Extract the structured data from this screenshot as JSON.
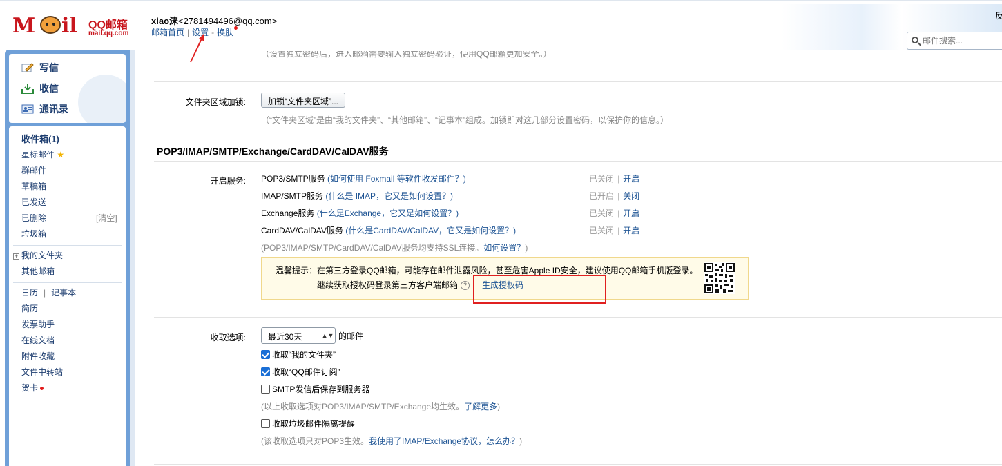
{
  "header": {
    "logo_text_m": "M",
    "logo_text_il": "il",
    "logo_brand": "QQ邮箱",
    "logo_url": "mail.qq.com",
    "account_name": "xiao涞",
    "account_email": "<2781494496@qq.com>",
    "link_home": "邮箱首页",
    "link_settings": "设置",
    "link_skin": "换肤",
    "corner_text": "反",
    "search_placeholder": "邮件搜索..."
  },
  "sidebar_top": {
    "write": "写信",
    "receive": "收信",
    "contacts": "通讯录"
  },
  "sidebar": {
    "inbox": "收件箱(1)",
    "starred": "星标邮件",
    "group": "群邮件",
    "drafts": "草稿箱",
    "sent": "已发送",
    "deleted": "已删除",
    "clear": "[清空]",
    "spam": "垃圾箱",
    "my_folders": "我的文件夹",
    "other_mail": "其他邮箱",
    "calendar": "日历",
    "notebook": "记事本",
    "resume": "简历",
    "invoice": "发票助手",
    "docs": "在线文档",
    "attachments": "附件收藏",
    "transfer": "文件中转站",
    "cards": "贺卡"
  },
  "settings": {
    "top_cut_note": "（设置独立密码后，进入邮箱需要输入独立密码验证，使用QQ邮箱更加安全。）",
    "folder_lock_label": "文件夹区域加锁:",
    "folder_lock_button": "加锁“文件夹区域”...",
    "folder_lock_note": "（“文件夹区域”是由“我的文件夹”、“其他邮箱”、“记事本”组成。加锁即对这几部分设置密码，以保护你的信息。）",
    "section_title": "POP3/IMAP/SMTP/Exchange/CardDAV/CalDAV服务",
    "enable_label": "开启服务:",
    "services": [
      {
        "name": "POP3/SMTP服务",
        "help": "(如何使用 Foxmail 等软件收发邮件？)",
        "status": "已关闭",
        "action": "开启"
      },
      {
        "name": "IMAP/SMTP服务",
        "help": "(什么是 IMAP，它又是如何设置？)",
        "status": "已开启",
        "action": "关闭"
      },
      {
        "name": "Exchange服务",
        "help": "(什么是Exchange，它又是如何设置？)",
        "status": "已关闭",
        "action": "开启"
      },
      {
        "name": "CardDAV/CalDAV服务",
        "help": "(什么是CardDAV/CalDAV，它又是如何设置？)",
        "status": "已关闭",
        "action": "开启"
      }
    ],
    "ssl_note": "(POP3/IMAP/SMTP/CardDAV/CalDAV服务均支持SSL连接。",
    "ssl_link": "如何设置？",
    "ssl_end": ")",
    "tip_line1": "温馨提示：在第三方登录QQ邮箱，可能存在邮件泄露风险，甚至危害Apple ID安全，建议使用QQ邮箱手机版登录。",
    "tip_line2": "继续获取授权码登录第三方客户端邮箱",
    "tip_help": "?",
    "tip_generate": "生成授权码",
    "receive_label": "收取选项:",
    "receive_select": "最近30天",
    "receive_suffix": "的邮件",
    "cb_my_folders": "收取“我的文件夹”",
    "cb_subscribe": "收取“QQ邮件订阅”",
    "cb_smtp_save": "SMTP发信后保存到服务器",
    "receive_note": "(以上收取选项对POP3/IMAP/SMTP/Exchange均生效。",
    "receive_note_link": "了解更多",
    "receive_note_end": ")",
    "cb_spam": "收取垃圾邮件隔离提醒",
    "pop3_note": "(该收取选项只对POP3生效。",
    "pop3_note_link": "我使用了IMAP/Exchange协议，怎么办？",
    "pop3_note_end": ")"
  },
  "checkboxes": {
    "my_folders": true,
    "subscribe": true,
    "smtp_save": false,
    "spam": false
  },
  "colors": {
    "frame": "#6fa0d8",
    "link": "#1e5494",
    "annotation": "#e02020"
  }
}
